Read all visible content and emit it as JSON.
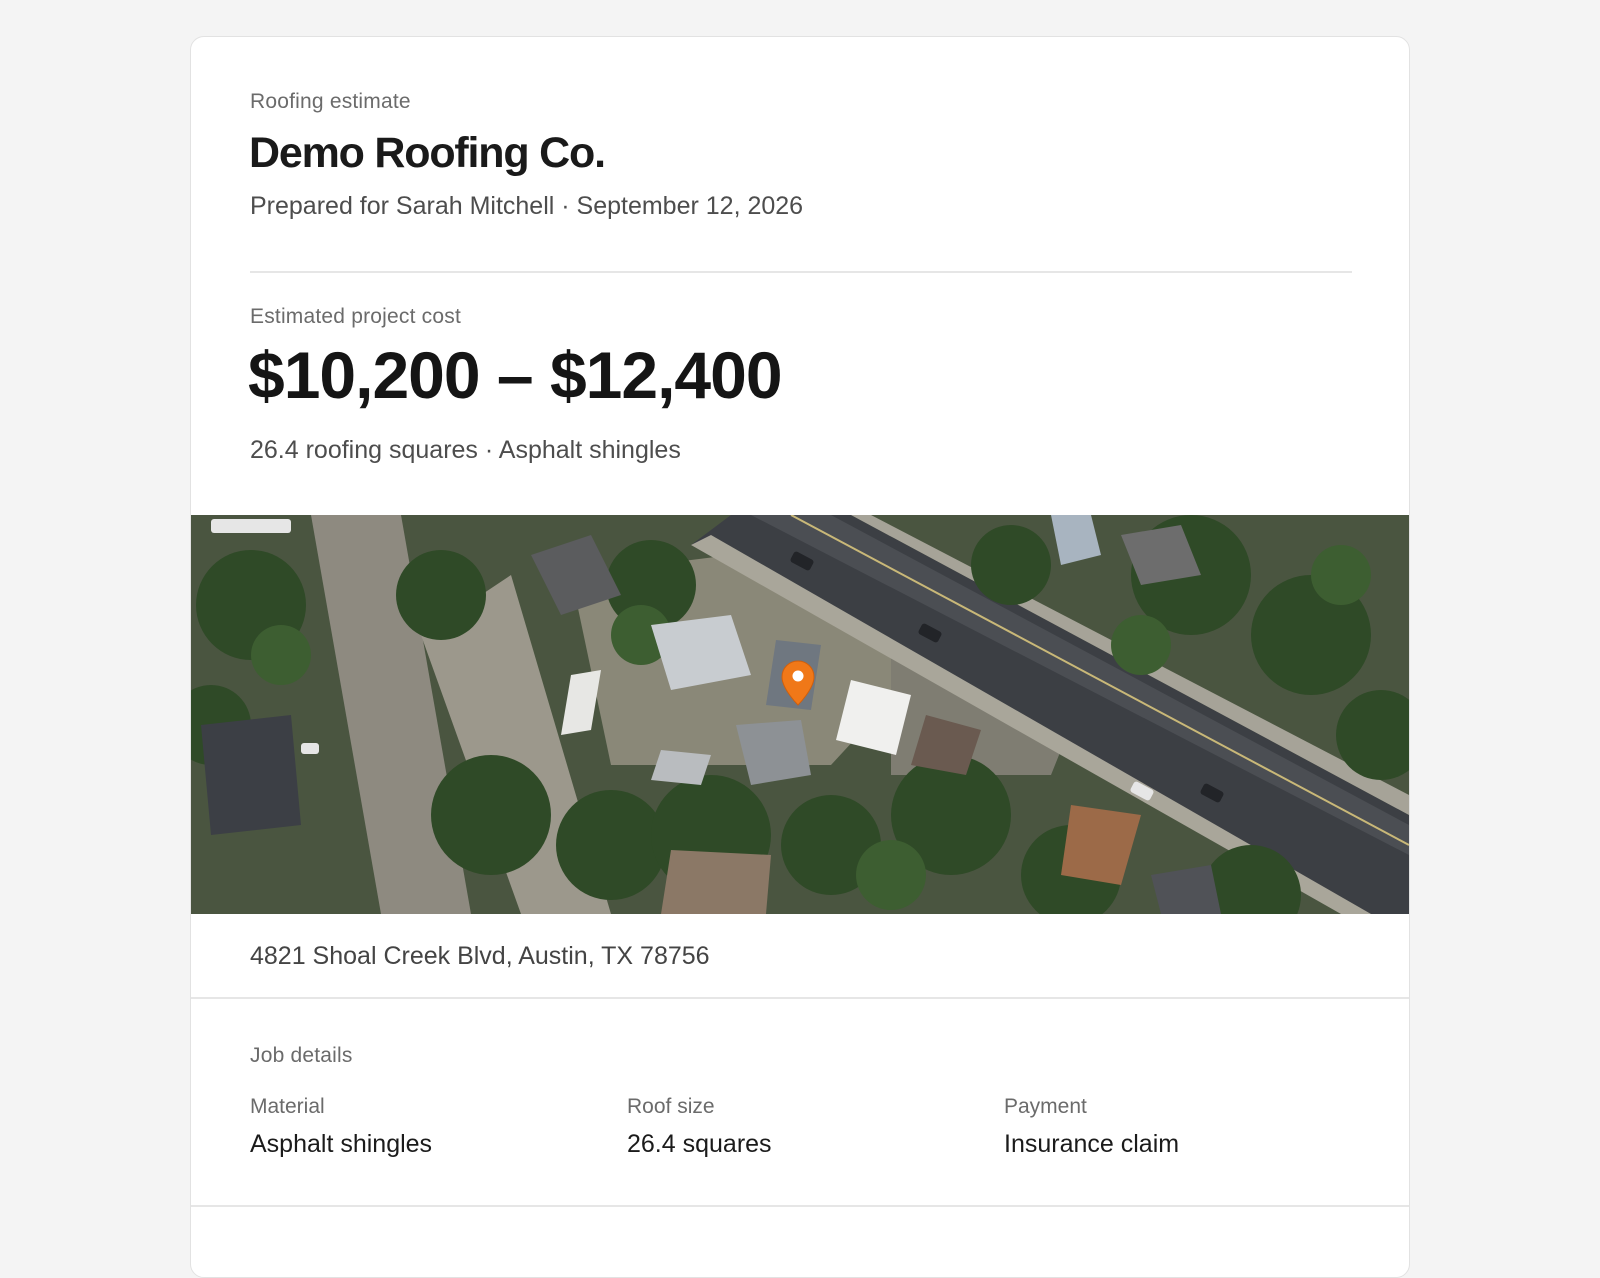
{
  "header": {
    "eyebrow": "Roofing estimate",
    "company": "Demo Roofing Co.",
    "prepared_line": "Prepared for Sarah Mitchell · September 12, 2026"
  },
  "estimate": {
    "label": "Estimated project cost",
    "range": "$10,200 – $12,400",
    "summary": "26.4 roofing squares · Asphalt shingles"
  },
  "map": {
    "pin_icon": "map-pin-icon",
    "pin_color": "#f07818",
    "address": "4821 Shoal Creek Blvd, Austin, TX 78756"
  },
  "job_details": {
    "heading": "Job details",
    "items": [
      {
        "label": "Material",
        "value": "Asphalt shingles"
      },
      {
        "label": "Roof size",
        "value": "26.4 squares"
      },
      {
        "label": "Payment",
        "value": "Insurance claim"
      }
    ]
  }
}
